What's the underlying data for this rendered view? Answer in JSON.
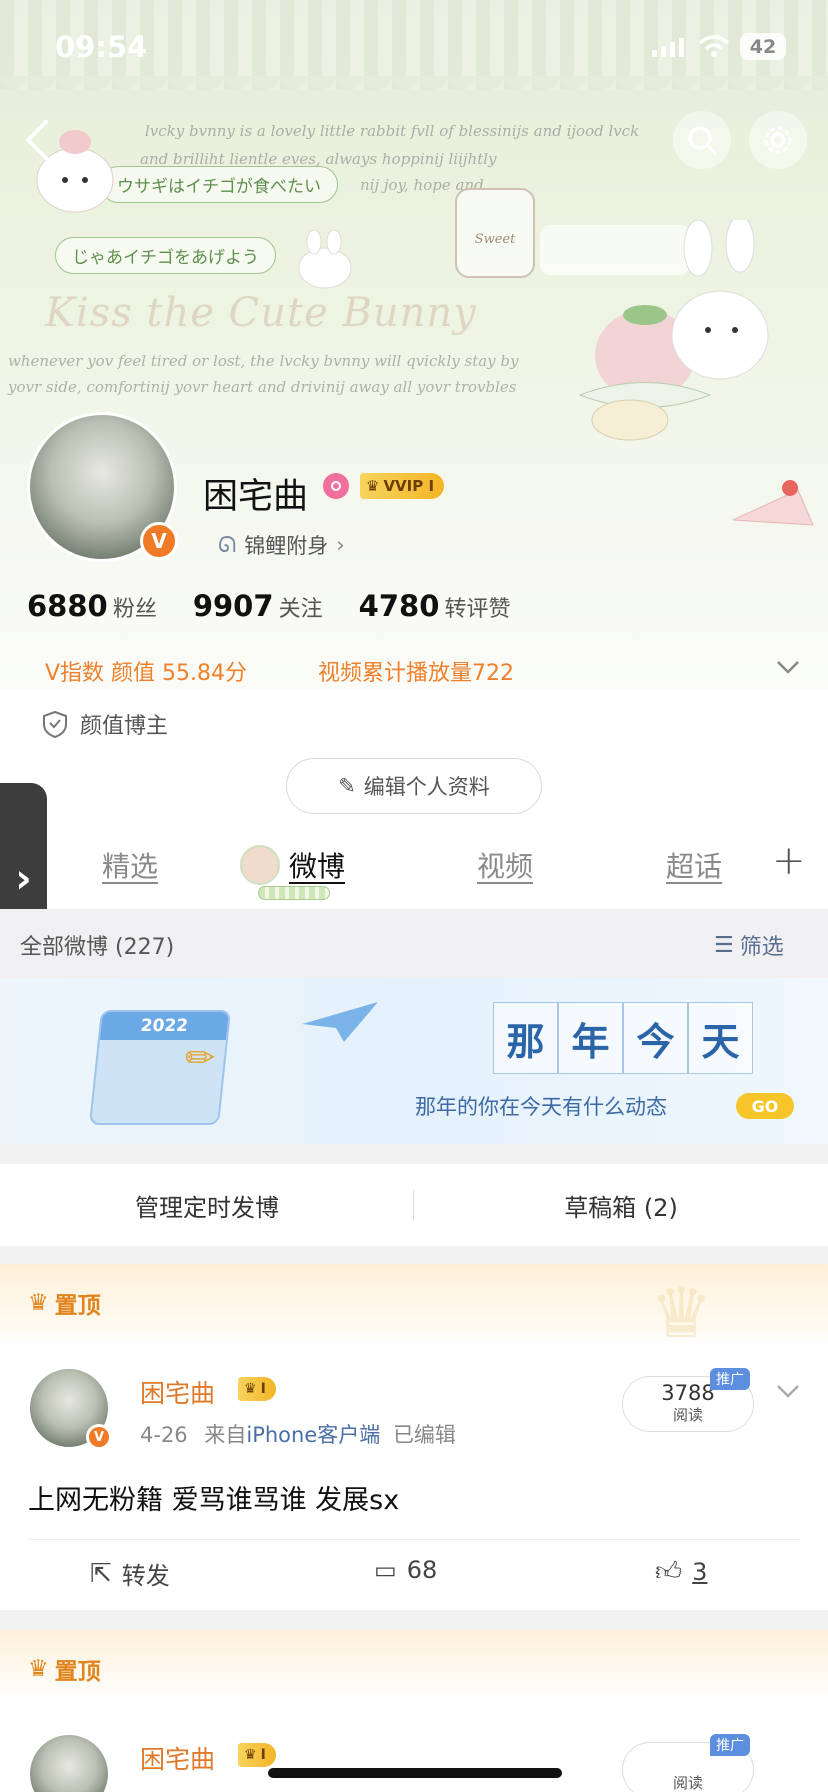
{
  "status_bar": {
    "time": "09:54",
    "battery": "42"
  },
  "banner": {
    "line1": "lvcky bvnny is a lovely little rabbit fvll of blessinijs and ijood lvck",
    "line2": "and brilliht lientle eves, always hoppinij liijhtly",
    "line3": "nij joy, hope and",
    "bubble1": "ウサギはイチゴが食べたい",
    "bubble2": "じゃあイチゴをあげよう",
    "title_art": "Kiss the Cute Bunny",
    "line4": "whenever yov feel tired or lost, the lvcky bvnny will qvickly stay by",
    "line5": "yovr side, comfortinij yovr heart and drivinij away all yovr trovbles",
    "jar_label": "Sweet"
  },
  "profile": {
    "name": "困宅曲",
    "vip_label": "VVIP I",
    "v_badge": "V",
    "koi_label": "锦鲤附身",
    "stats": [
      {
        "num": "6880",
        "label": "粉丝"
      },
      {
        "num": "9907",
        "label": "关注"
      },
      {
        "num": "4780",
        "label": "转评赞"
      }
    ],
    "v_index": "V指数 颜值 55.84分",
    "video_plays": "视频累计播放量722",
    "tag": "颜值博主",
    "edit_button": "编辑个人资料"
  },
  "tabs": [
    "精选",
    "微博",
    "视频",
    "超话"
  ],
  "weibo_bar": {
    "label": "全部微博 (227)",
    "filter": "筛选"
  },
  "promo": {
    "calendar_year": "2022",
    "title_chars": [
      "那",
      "年",
      "今",
      "天"
    ],
    "subtitle": "那年的你在今天有什么动态",
    "go": "GO"
  },
  "actions": {
    "scheduled": "管理定时发博",
    "drafts": "草稿箱 (2)"
  },
  "pinned_label": "置顶",
  "post": {
    "author": "困宅曲",
    "vip_small": "I",
    "date": "4-26",
    "source_prefix": "来自",
    "source": "iPhone客户端",
    "edited": "已编辑",
    "reads": "3788",
    "reads_label": "阅读",
    "promote": "推广",
    "content": "上网无粉籍 爱骂谁骂谁 发展sx",
    "repost": "转发",
    "comments": "68",
    "likes": "3"
  },
  "post2": {
    "author": "困宅曲",
    "vip_small": "I",
    "promote": "推广",
    "reads_label": "阅读"
  },
  "colors": {
    "accent": "#f0802b",
    "link_blue": "#4a6ea8",
    "pinned_orange": "#e2841c"
  }
}
